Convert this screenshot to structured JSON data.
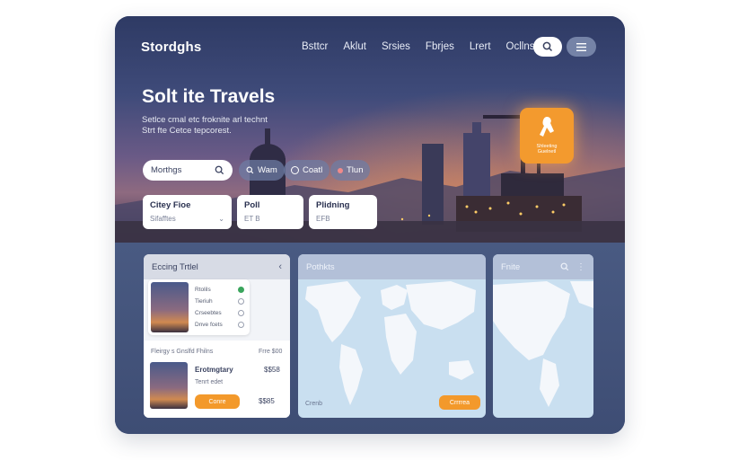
{
  "header": {
    "logo": "Stordghs",
    "nav": [
      "Bsttcr",
      "Aklut",
      "Srsies",
      "Fbrjes",
      "Lrert",
      "Ocllns"
    ]
  },
  "hero": {
    "title": "Solt ite Travels",
    "subtitle_line1": "Setlce cmal etc froknite arl technt",
    "subtitle_line2": "Strt fte Cetce tepcorest."
  },
  "search": {
    "placeholder": "Morthgs",
    "chips": [
      "Wam",
      "Coatl",
      "Tlun"
    ]
  },
  "fields": [
    {
      "label": "Citey Fioe",
      "value": "Sifafftes"
    },
    {
      "label": "Poll",
      "value": "ET B"
    },
    {
      "label": "Plidning",
      "value": "EFB"
    }
  ],
  "badge": {
    "text_line1": "Shleeting",
    "text_line2": "Guelnetl"
  },
  "panels": {
    "left": {
      "title": "Eccing Trtlel",
      "rows": [
        "Rtolils",
        "Tieriuh",
        "Crseebtes",
        "Dnve fcets"
      ],
      "section_label": "Fleirgy s Gnslfd Fhilns",
      "section_price": "Frre $00",
      "item_title": "Erotmgtary",
      "item_sub": "Tenrt edet",
      "item_price": "$$58",
      "button": "Conre",
      "item_price2": "$$85"
    },
    "middle": {
      "title": "Pothkts",
      "footer_label": "Crenb",
      "button": "Crrrrea"
    },
    "right": {
      "title": "Fnite"
    }
  }
}
